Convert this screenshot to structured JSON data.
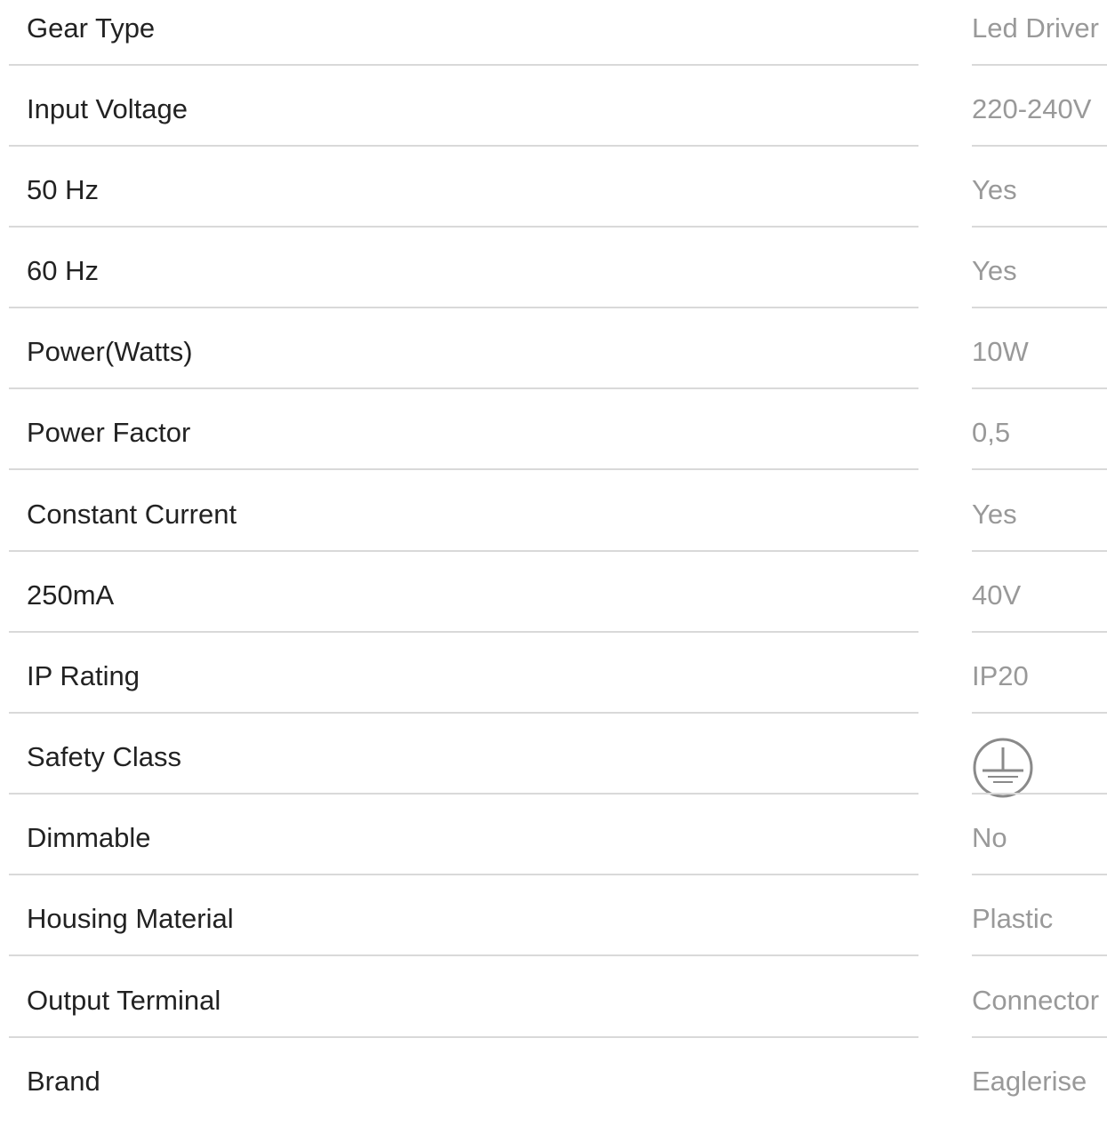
{
  "specs": [
    {
      "label": "Gear Type",
      "value": "Led Driver"
    },
    {
      "label": "Input Voltage",
      "value": "220-240V"
    },
    {
      "label": "50 Hz",
      "value": "Yes"
    },
    {
      "label": "60 Hz",
      "value": "Yes"
    },
    {
      "label": "Power(Watts)",
      "value": "10W"
    },
    {
      "label": "Power Factor",
      "value": "0,5"
    },
    {
      "label": "Constant Current",
      "value": "Yes"
    },
    {
      "label": "250mA",
      "value": "40V"
    },
    {
      "label": "IP Rating",
      "value": "IP20"
    },
    {
      "label": "Safety Class",
      "icon": "protective-earth-icon"
    },
    {
      "label": "Dimmable",
      "value": "No"
    },
    {
      "label": "Housing Material",
      "value": "Plastic"
    },
    {
      "label": "Output Terminal",
      "value": "Connector"
    },
    {
      "label": "Brand",
      "value": "Eaglerise"
    }
  ],
  "colors": {
    "label": "#222222",
    "value": "#999999",
    "divider": "#d9d9d9",
    "icon": "#8a8a8a"
  }
}
